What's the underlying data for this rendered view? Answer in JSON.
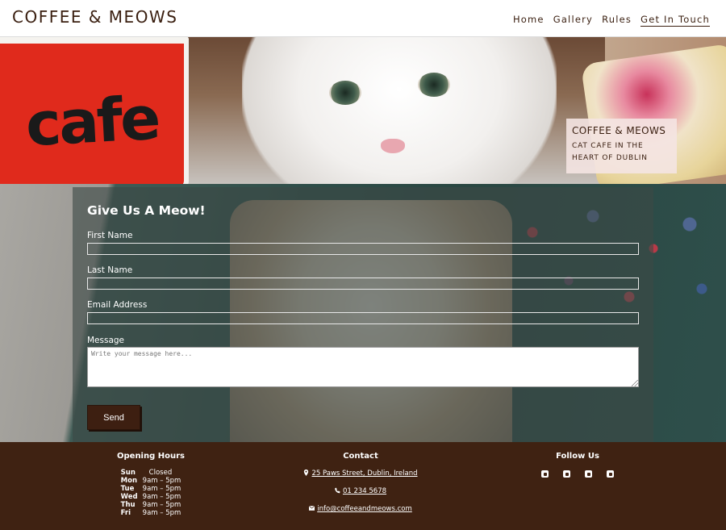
{
  "header": {
    "brand": "COFFEE & MEOWS",
    "nav": [
      {
        "label": "Home"
      },
      {
        "label": "Gallery"
      },
      {
        "label": "Rules"
      },
      {
        "label": "Get In Touch",
        "active": true
      }
    ]
  },
  "hero": {
    "cup_text": "cafe",
    "card_title": "COFFEE & MEOWS",
    "card_subtitle": "CAT CAFE IN THE HEART OF DUBLIN"
  },
  "form": {
    "title": "Give Us A Meow!",
    "first_name_label": "First Name",
    "first_name_value": "",
    "last_name_label": "Last Name",
    "last_name_value": "",
    "email_label": "Email Address",
    "email_value": "",
    "message_label": "Message",
    "message_placeholder": "Write your message here...",
    "send_label": "Send"
  },
  "footer": {
    "hours_title": "Opening Hours",
    "hours": [
      {
        "day": "Sun",
        "time": "Closed"
      },
      {
        "day": "Mon",
        "time": "9am – 5pm"
      },
      {
        "day": "Tue",
        "time": "9am – 5pm"
      },
      {
        "day": "Wed",
        "time": "9am – 5pm"
      },
      {
        "day": "Thu",
        "time": "9am – 5pm"
      },
      {
        "day": "Fri",
        "time": "9am – 5pm"
      }
    ],
    "contact_title": "Contact",
    "address": "25 Paws Street, Dublin, Ireland",
    "phone": "01 234 5678",
    "email": "info@coffeeandmeows.com",
    "follow_title": "Follow Us",
    "social_icons": [
      "facebook-icon",
      "twitter-icon",
      "instagram-icon",
      "youtube-icon"
    ]
  },
  "colors": {
    "brand_brown": "#3f2212",
    "button_brown": "#3d1f11",
    "card_pink": "#f4e4e2"
  }
}
